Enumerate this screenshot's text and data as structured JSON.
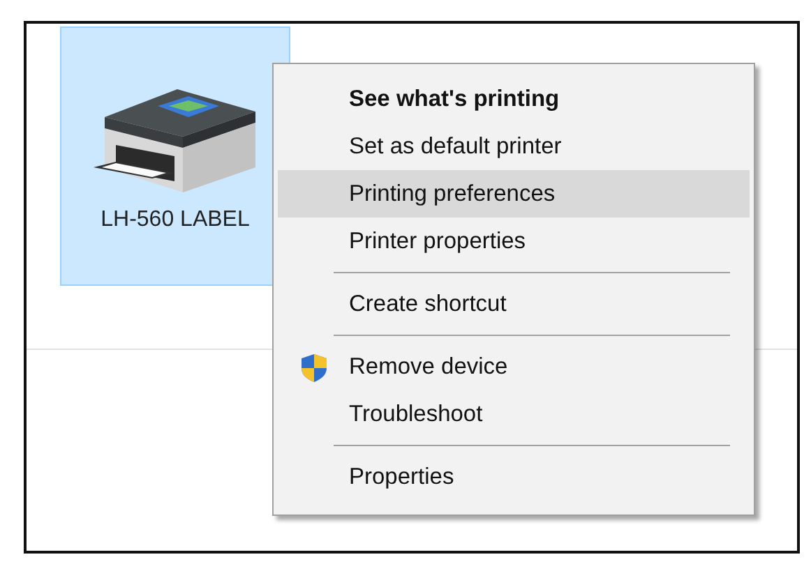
{
  "device": {
    "label": "LH-560 LABEL",
    "selected": true
  },
  "context_menu": {
    "items": [
      {
        "kind": "item",
        "label": "See what's printing",
        "default": true,
        "selected": false
      },
      {
        "kind": "item",
        "label": "Set as default printer",
        "default": false,
        "selected": false
      },
      {
        "kind": "item",
        "label": "Printing preferences",
        "default": false,
        "selected": true
      },
      {
        "kind": "item",
        "label": "Printer properties",
        "default": false,
        "selected": false
      },
      {
        "kind": "separator"
      },
      {
        "kind": "item",
        "label": "Create shortcut",
        "default": false,
        "selected": false
      },
      {
        "kind": "separator"
      },
      {
        "kind": "admin",
        "label": "Remove device",
        "default": false,
        "selected": false
      },
      {
        "kind": "item",
        "label": "Troubleshoot",
        "default": false,
        "selected": false
      },
      {
        "kind": "separator"
      },
      {
        "kind": "item",
        "label": "Properties",
        "default": false,
        "selected": false
      }
    ]
  }
}
